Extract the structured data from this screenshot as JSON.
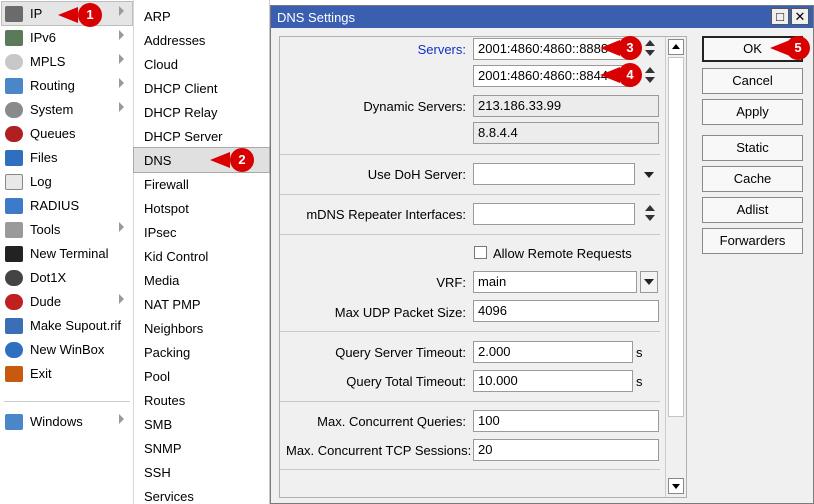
{
  "menu": {
    "items": [
      {
        "label": "IP",
        "icon": "ip-icon",
        "arrow": true
      },
      {
        "label": "IPv6",
        "icon": "ipv6-icon",
        "arrow": true
      },
      {
        "label": "MPLS",
        "icon": "mpls-icon",
        "arrow": true
      },
      {
        "label": "Routing",
        "icon": "routing-icon",
        "arrow": true
      },
      {
        "label": "System",
        "icon": "gear-icon",
        "arrow": true
      },
      {
        "label": "Queues",
        "icon": "queues-icon",
        "arrow": false
      },
      {
        "label": "Files",
        "icon": "folder-icon",
        "arrow": false
      },
      {
        "label": "Log",
        "icon": "log-icon",
        "arrow": false
      },
      {
        "label": "RADIUS",
        "icon": "radius-icon",
        "arrow": false
      },
      {
        "label": "Tools",
        "icon": "tools-icon",
        "arrow": true
      },
      {
        "label": "New Terminal",
        "icon": "terminal-icon",
        "arrow": false
      },
      {
        "label": "Dot1X",
        "icon": "dot1x-icon",
        "arrow": false
      },
      {
        "label": "Dude",
        "icon": "dude-icon",
        "arrow": true
      },
      {
        "label": "Make Supout.rif",
        "icon": "supout-icon",
        "arrow": false
      },
      {
        "label": "New WinBox",
        "icon": "winbox-icon",
        "arrow": false
      },
      {
        "label": "Exit",
        "icon": "exit-icon",
        "arrow": false
      }
    ],
    "windows_label": "Windows"
  },
  "submenu": {
    "items": [
      "ARP",
      "Addresses",
      "Cloud",
      "DHCP Client",
      "DHCP Relay",
      "DHCP Server",
      "DNS",
      "Firewall",
      "Hotspot",
      "IPsec",
      "Kid Control",
      "Media",
      "NAT PMP",
      "Neighbors",
      "Packing",
      "Pool",
      "Routes",
      "SMB",
      "SNMP",
      "SSH",
      "Services"
    ]
  },
  "dialog": {
    "title": "DNS Settings",
    "max_btn": "□",
    "close_btn": "✕",
    "servers_label": "Servers:",
    "server1": "2001:4860:4860::8888",
    "server2": "2001:4860:4860::8844",
    "dynamic_servers_label": "Dynamic Servers:",
    "dynamic1": "213.186.33.99",
    "dynamic2": "8.8.4.4",
    "doh_label": "Use DoH Server:",
    "doh_value": "",
    "mdns_label": "mDNS Repeater Interfaces:",
    "mdns_value": "",
    "allow_remote_label": "Allow Remote Requests",
    "allow_remote_checked": false,
    "vrf_label": "VRF:",
    "vrf_value": "main",
    "max_udp_label": "Max UDP Packet Size:",
    "max_udp_value": "4096",
    "query_server_timeout_label": "Query Server Timeout:",
    "query_server_timeout_value": "2.000",
    "query_server_timeout_unit": "s",
    "query_total_timeout_label": "Query Total Timeout:",
    "query_total_timeout_value": "10.000",
    "query_total_timeout_unit": "s",
    "max_concurrent_label": "Max. Concurrent Queries:",
    "max_concurrent_value": "100",
    "max_tcp_label": "Max. Concurrent TCP Sessions:",
    "max_tcp_value": "20"
  },
  "buttons": {
    "ok": "OK",
    "cancel": "Cancel",
    "apply": "Apply",
    "static": "Static",
    "cache": "Cache",
    "adlist": "Adlist",
    "forwarders": "Forwarders"
  },
  "callouts": [
    "1",
    "2",
    "3",
    "4",
    "5"
  ],
  "colors": {
    "callout": "#d80000",
    "titlebar": "#3a5fb0",
    "servers_label": "#1030c8"
  }
}
